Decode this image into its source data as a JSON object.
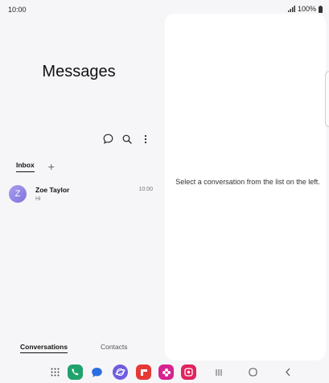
{
  "status_bar": {
    "time": "10:00",
    "battery": "100%"
  },
  "app": {
    "title": "Messages"
  },
  "toolbar": {
    "icons": [
      "new-chat-icon",
      "search-icon",
      "more-options-icon"
    ]
  },
  "tabs": {
    "inbox": "Inbox",
    "add": "+"
  },
  "conversations": [
    {
      "avatar_letter": "Z",
      "name": "Zoe Taylor",
      "preview": "Hi",
      "time": "10:00"
    }
  ],
  "bottom_tabs": {
    "conversations": "Conversations",
    "contacts": "Contacts"
  },
  "detail": {
    "empty_hint": "Select a conversation from the list on the left."
  },
  "colors": {
    "avatar": "#8f85e6",
    "phone_app": "#1fa36b",
    "messages_app": "#2a6fe0",
    "internet_app": "#6f5ce0",
    "flipboard_app": "#e53935",
    "blossom_app": "#d6248f",
    "screen_recorder_app": "#e0245e"
  },
  "dock": {
    "apps": [
      "apps-grid-icon",
      "phone-icon",
      "messages-icon",
      "internet-icon",
      "flipboard-icon",
      "blossom-icon",
      "screen-recorder-icon"
    ]
  },
  "nav": {
    "buttons": [
      "recents-icon",
      "home-icon",
      "back-icon"
    ]
  }
}
